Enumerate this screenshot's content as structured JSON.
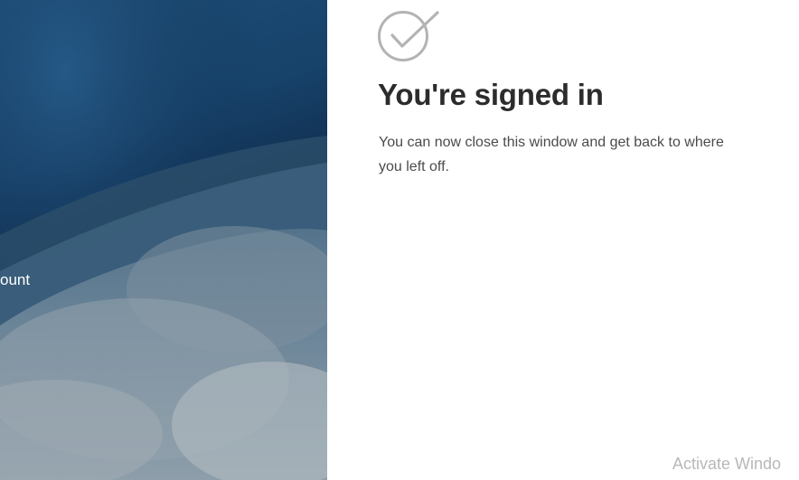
{
  "sidebar": {
    "partial_text": "ount"
  },
  "content": {
    "icon": "check-circle-icon",
    "title": "You're signed in",
    "message": "You can now close this window and get back to where you left off."
  },
  "watermark": {
    "text": "Activate Windo"
  },
  "colors": {
    "title": "#2c2c2c",
    "message": "#4b4b4b",
    "icon": "#b3b3b3",
    "background_dark": "#0f2a4a"
  }
}
